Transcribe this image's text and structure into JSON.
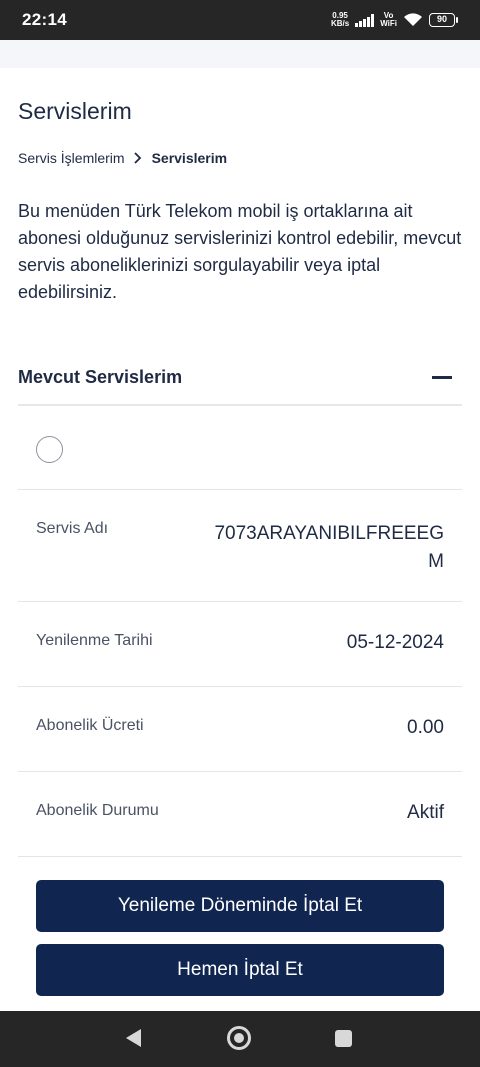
{
  "status_bar": {
    "time": "22:14",
    "net_speed_value": "0.95",
    "net_speed_unit": "KB/s",
    "volte_top": "Vo",
    "volte_bottom": "WiFi",
    "battery": "90"
  },
  "page": {
    "title": "Servislerim",
    "breadcrumb": {
      "parent": "Servis İşlemlerim",
      "current": "Servislerim"
    },
    "intro": "Bu menüden Türk Telekom mobil iş ortaklarına ait abonesi olduğunuz servislerinizi kontrol edebilir, mevcut servis aboneliklerinizi sorgulayabilir veya iptal edebilirsiniz."
  },
  "section": {
    "title": "Mevcut Servislerim",
    "fields": [
      {
        "label": "Servis Adı",
        "value": "7073ARAYANIBILFREEEGM"
      },
      {
        "label": "Yenilenme Tarihi",
        "value": "05-12-2024"
      },
      {
        "label": "Abonelik Ücreti",
        "value": "0.00"
      },
      {
        "label": "Abonelik Durumu",
        "value": "Aktif"
      }
    ]
  },
  "actions": {
    "cancel_on_renewal": "Yenileme Döneminde İptal Et",
    "cancel_now": "Hemen İptal Et"
  },
  "colors": {
    "primary": "#102650",
    "text": "#1f2a44",
    "label": "#4a5264",
    "system_bar": "#262626"
  }
}
